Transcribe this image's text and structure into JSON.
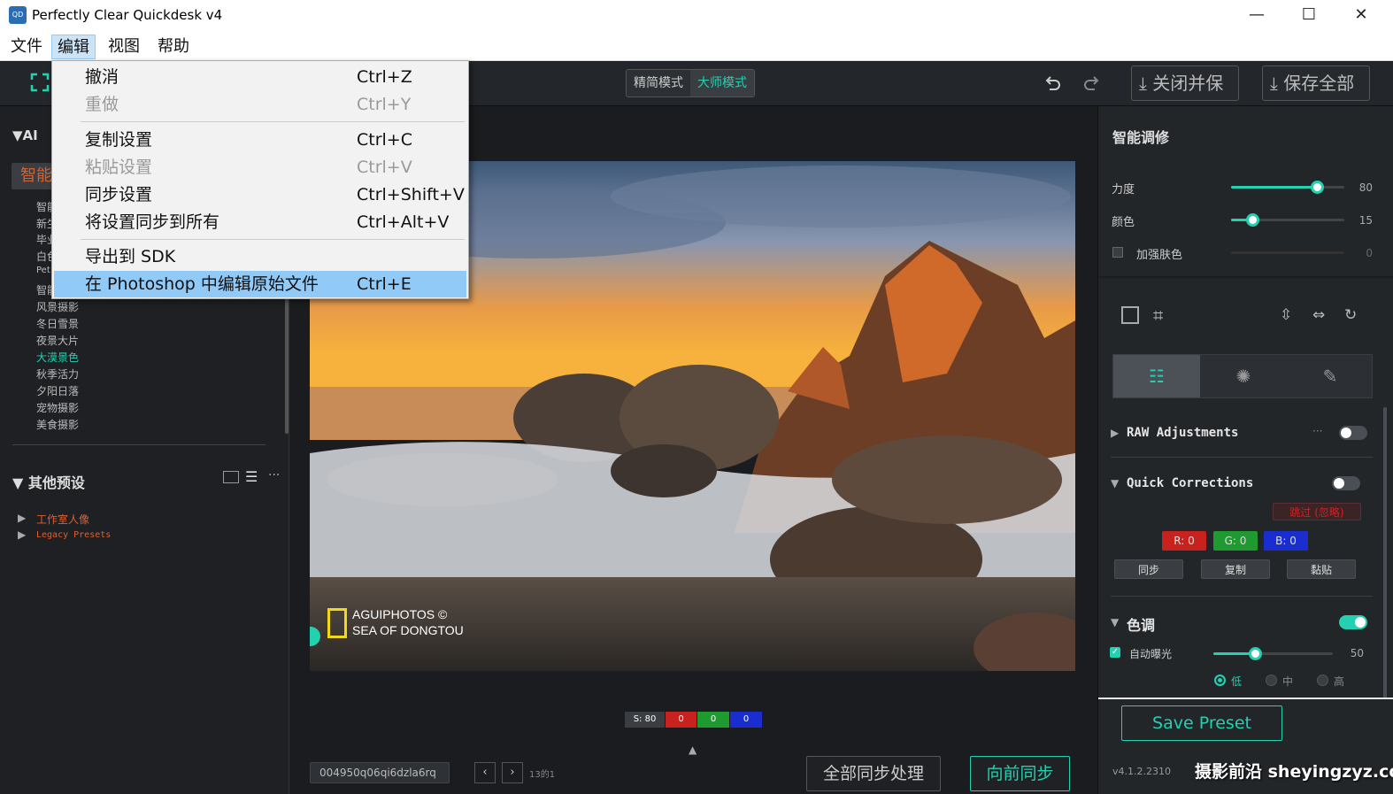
{
  "window": {
    "title": "Perfectly Clear Quickdesk v4",
    "icon_text": "QD",
    "minimize": "—",
    "maximize": "☐",
    "close": "✕"
  },
  "menubar": [
    "文件",
    "编辑",
    "视图",
    "帮助"
  ],
  "edit_menu": [
    {
      "label": "撤消",
      "shortcut": "Ctrl+Z",
      "enabled": true
    },
    {
      "label": "重做",
      "shortcut": "Ctrl+Y",
      "enabled": false
    },
    {
      "label": "复制设置",
      "shortcut": "Ctrl+C",
      "enabled": true
    },
    {
      "label": "粘贴设置",
      "shortcut": "Ctrl+V",
      "enabled": false
    },
    {
      "label": "同步设置",
      "shortcut": "Ctrl+Shift+V",
      "enabled": true
    },
    {
      "label": "将设置同步到所有",
      "shortcut": "Ctrl+Alt+V",
      "enabled": true
    },
    {
      "label": "导出到 SDK",
      "shortcut": "",
      "enabled": true
    },
    {
      "label": "在 Photoshop 中编辑原始文件",
      "shortcut": "Ctrl+E",
      "enabled": true,
      "highlighted": true
    }
  ],
  "toolbar": {
    "mode_simple": "精简模式",
    "mode_master": "大师模式",
    "close_save": "关闭并保",
    "save_all": "保存全部"
  },
  "left": {
    "ai_section": "AI",
    "ai_selected_preview": "智能",
    "presets": [
      "智能",
      "新生",
      "毕业",
      "白色",
      "Pet",
      "智能",
      "风景摄影",
      "冬日雪景",
      "夜景大片",
      "大漠景色",
      "秋季活力",
      "夕阳日落",
      "宠物摄影",
      "美食摄影"
    ],
    "selected_preset": "大漠景色",
    "other_section": "其他预设",
    "other_items": [
      "工作室人像",
      "Legacy Presets"
    ]
  },
  "photo": {
    "watermark_line1": "AGUIPHOTOS ©",
    "watermark_line2": "SEA OF DONGTOU"
  },
  "center": {
    "strip": {
      "s": "S: 80",
      "r": "0",
      "g": "0",
      "b": "0"
    },
    "filename": "004950q06qi6dzla6rq",
    "counter": "13的1",
    "sync_all": "全部同步处理",
    "sync_forward": "向前同步"
  },
  "right": {
    "smart_title": "智能调修",
    "strength_label": "力度",
    "strength_value": "80",
    "color_label": "颜色",
    "color_value": "15",
    "skin_label": "加强肤色",
    "skin_value": "0",
    "raw_title": "RAW Adjustments",
    "quick_title": "Quick Corrections",
    "skip_label": "跳过 (忽略)",
    "r": "R: 0",
    "g": "G: 0",
    "b": "B: 0",
    "sync": "同步",
    "copy": "复制",
    "paste": "黏贴",
    "tone_title": "色调",
    "auto_exposure": "自动曝光",
    "auto_exposure_value": "50",
    "opt_low": "低",
    "opt_mid": "中",
    "opt_high": "高",
    "save_preset": "Save Preset",
    "version": "v4.1.2.2310"
  },
  "watermark_site": "摄影前沿 sheyingzyz.com",
  "colors": {
    "accent": "#23d1b0",
    "bg": "#1e2023",
    "menu_highlight": "#91c9f7"
  }
}
